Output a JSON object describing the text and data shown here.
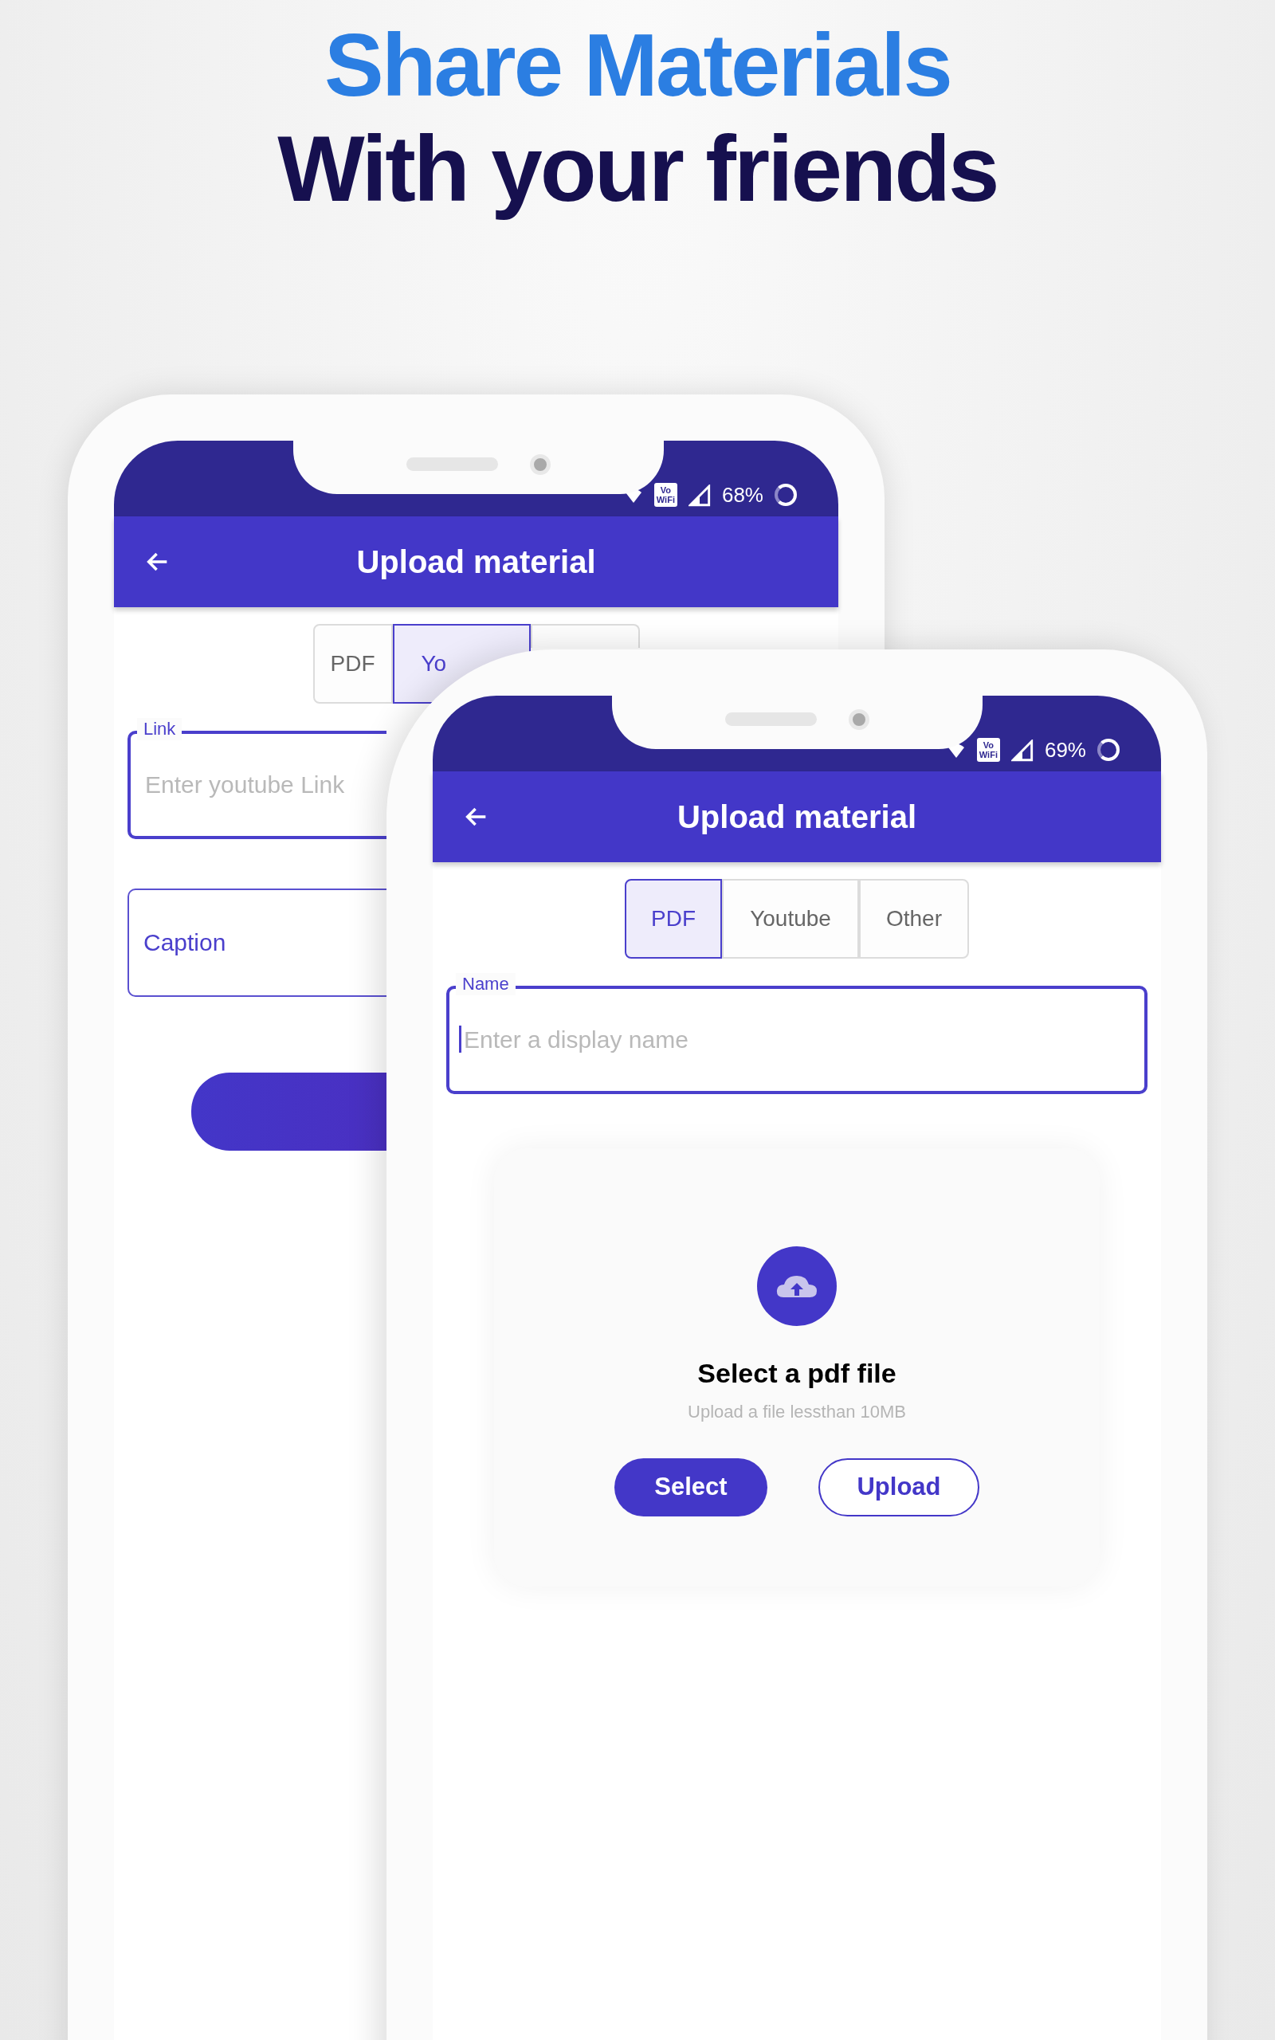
{
  "headline": {
    "line_1": "Share Materials",
    "line_2": "With your friends"
  },
  "back_phone": {
    "status_bar": {
      "wifi_calling": [
        "Vo",
        "WiFi"
      ],
      "battery": "68%"
    },
    "app_bar": {
      "title": "Upload material"
    },
    "tabs": [
      {
        "label": "PDF",
        "selected": false
      },
      {
        "label": "Yo",
        "selected": true
      }
    ],
    "fields": [
      {
        "label": "Link",
        "placeholder": "Enter youtube Link",
        "focused": true
      },
      {
        "placeholder": "Caption",
        "focused": false
      }
    ],
    "action_button": {
      "kind": "gradient"
    }
  },
  "front_phone": {
    "status_bar": {
      "wifi_calling": [
        "Vo",
        "WiFi"
      ],
      "battery": "69%"
    },
    "app_bar": {
      "title": "Upload material"
    },
    "tabs": [
      {
        "label": "PDF",
        "selected": true
      },
      {
        "label": "Youtube",
        "selected": false
      },
      {
        "label": "Other",
        "selected": false
      }
    ],
    "fields": [
      {
        "label": "Name",
        "placeholder": "Enter a display name",
        "focused": true,
        "cursor": true
      }
    ],
    "upload": {
      "title": "Select a pdf file",
      "hint": "Upload a file lessthan 10MB",
      "buttons": [
        {
          "label": "Select",
          "kind": "filled"
        },
        {
          "label": "Upload",
          "kind": "outlined"
        }
      ]
    }
  }
}
